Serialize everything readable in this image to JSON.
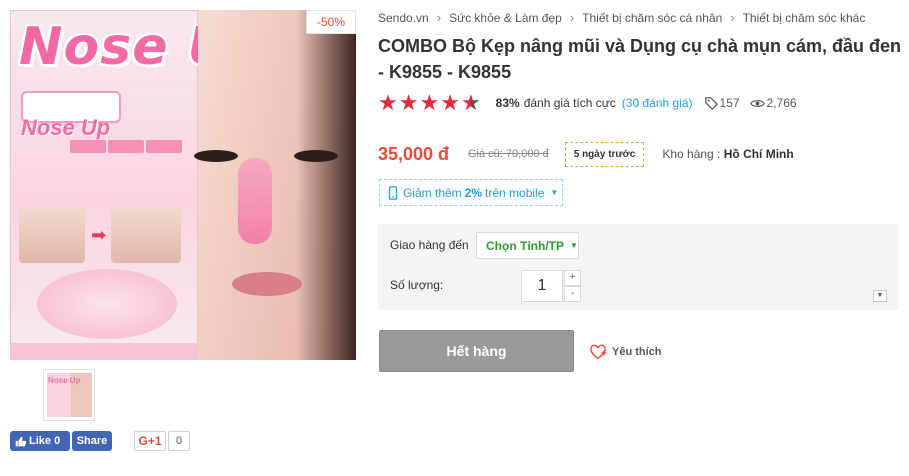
{
  "product_image": {
    "discount_badge": "-50%",
    "package_brand": "Nose Up",
    "package_logo": "Nose Up"
  },
  "thumbnail": {
    "label": "Nose Up"
  },
  "social": {
    "fb_like": "Like 0",
    "fb_share": "Share",
    "gplus": "G+1",
    "gplus_count": "0"
  },
  "breadcrumb": [
    "Sendo.vn",
    "Sức khỏe & Làm đẹp",
    "Thiết bị chăm sóc cá nhân",
    "Thiết bị chăm sóc khác"
  ],
  "product": {
    "title": "COMBO Bộ Kẹp nâng mũi và Dụng cụ chà mụn cám, đầu đen - K9855 - K9855",
    "rating_stars": 4.5,
    "rating_percent": "83%",
    "rating_text": "đánh giá tích cực",
    "rating_count": "(30 đánh giá)",
    "tag_count": "157",
    "view_count": "2,766",
    "price": "35,000 đ",
    "old_price": "Giá cũ: 70,000 đ",
    "timer": "5 ngày trước",
    "warehouse_label": "Kho hàng :",
    "warehouse_value": "Hồ Chí Minh"
  },
  "mobile_promo": {
    "prefix": "Giảm thêm",
    "value": "2%",
    "suffix": "trên mobile"
  },
  "shipping": {
    "label": "Giao hàng đến",
    "select_value": "Chọn Tỉnh/TP",
    "qty_label": "Số lượng:",
    "qty_value": "1",
    "plus": "+",
    "minus": "-"
  },
  "actions": {
    "out_of_stock": "Hết hàng",
    "favorite": "Yêu thích"
  },
  "colors": {
    "price_red": "#e84b38",
    "link_blue": "#1d9fd8",
    "fb_blue": "#4267b2",
    "select_green": "#2a9d2a"
  }
}
